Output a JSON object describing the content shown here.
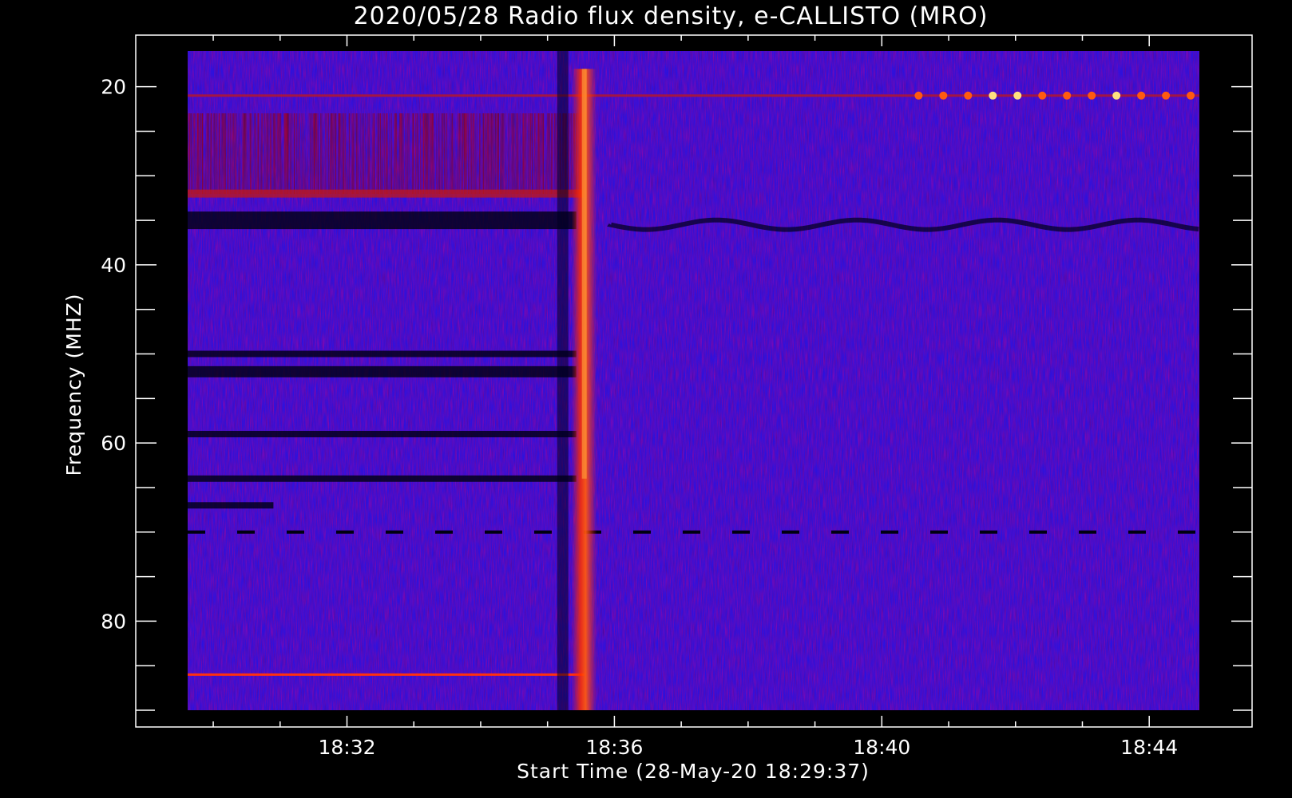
{
  "chart_data": {
    "type": "heatmap",
    "title": "2020/05/28  Radio flux density, e-CALLISTO (MRO)",
    "xlabel": "Start Time (28-May-20 18:29:37)",
    "ylabel": "Frequency (MHZ)",
    "x_ticks": [
      "18:32",
      "18:36",
      "18:40",
      "18:44"
    ],
    "y_ticks": [
      "20",
      "40",
      "60",
      "80"
    ],
    "x_tick_minutes": [
      32,
      36,
      40,
      44
    ],
    "y_tick_values": [
      20,
      40,
      60,
      80
    ],
    "xlim_minutes": [
      29.617,
      44.75
    ],
    "ylim_mhz": [
      16,
      90
    ],
    "y_axis_inverted": true,
    "colormap": [
      "#000000",
      "#1a00c8",
      "#3a10f0",
      "#c01010",
      "#ff3a00",
      "#ffcc30",
      "#ffffff"
    ],
    "background_color": "#2a12e0",
    "grid": false,
    "features": {
      "burst_time_minutes": 35.55,
      "burst_freq_range_mhz": [
        18,
        90
      ],
      "quiet_region_start_minutes": 35.95,
      "dark_bands_mhz_before_burst": [
        35,
        50,
        52,
        59,
        64,
        67
      ],
      "bright_bands_mhz_before_burst": [
        21,
        32,
        86
      ],
      "dashed_dark_line_mhz": 70,
      "bright_spots_mhz": 21
    }
  }
}
